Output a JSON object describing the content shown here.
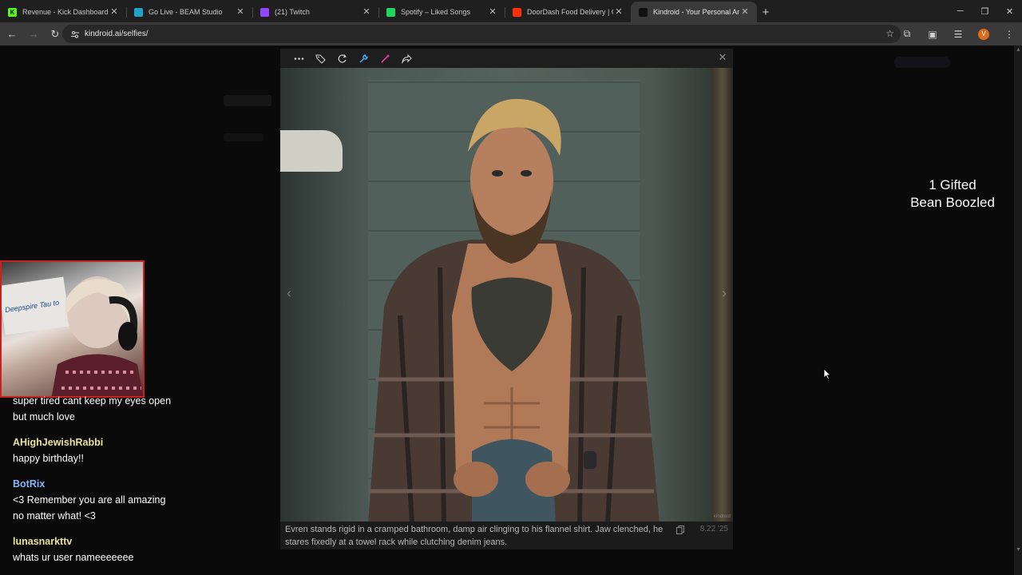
{
  "browser": {
    "tabs": [
      {
        "title": "Revenue - Kick Dashboard",
        "fav": "K",
        "color": "#53fc18",
        "fav_fg": "#000000"
      },
      {
        "title": "Go Live - BEAM Studio",
        "fav": "",
        "color": "#1fa3c9",
        "fav_fg": "#ffffff"
      },
      {
        "title": "(21) Twitch",
        "fav": "",
        "color": "#9146ff",
        "fav_fg": "#ffffff"
      },
      {
        "title": "Spotify – Liked Songs",
        "fav": "",
        "color": "#1ed760",
        "fav_fg": "#000000"
      },
      {
        "title": "DoorDash Food Delivery | Chec",
        "fav": "",
        "color": "#ff3008",
        "fav_fg": "#ffffff"
      },
      {
        "title": "Kindroid - Your Personal Artific",
        "fav": "",
        "color": "#111111",
        "fav_fg": "#ffffff"
      }
    ],
    "active_tab": 5,
    "new_tab": "+",
    "close_glyph": "✕",
    "url": "kindroid.ai/selfies/",
    "profile_initial": "V"
  },
  "modal": {
    "caption": "Evren stands rigid in a cramped bathroom, damp air clinging to his flannel shirt. Jaw clenched, he stares fixedly at a towel rack while clutching denim jeans.",
    "date": "8.22 '25",
    "close": "✕",
    "watermark": "kindroid"
  },
  "stream": {
    "webcam_poster": "Deepspire Tau to",
    "chat": [
      {
        "user": "",
        "user_color": "#ffffff",
        "message": "super tired cant keep my eyes open but much love"
      },
      {
        "user": "AHighJewishRabbi",
        "user_color": "#e8e39a",
        "message": "happy birthday!!"
      },
      {
        "user": "BotRix",
        "user_color": "#8ab4f8",
        "message": "<3 Remember you are all amazing no matter what! <3"
      },
      {
        "user": "lunasnarkttv",
        "user_color": "#e8e39a",
        "message": "whats ur user nameeeeeee"
      }
    ],
    "alert_line1": "1 Gifted",
    "alert_line2": "Bean Boozled"
  }
}
